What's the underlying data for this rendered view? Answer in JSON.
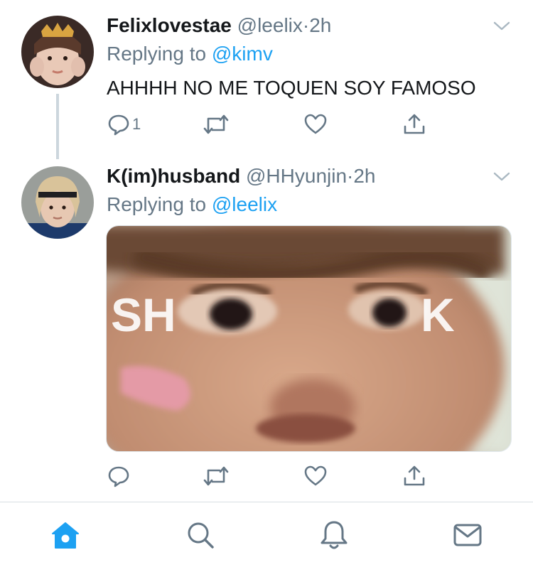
{
  "colors": {
    "accent": "#1da1f2",
    "secondary_text": "#657786",
    "icon_gray": "#657786",
    "thread_line": "#ccd6dd"
  },
  "tweets": [
    {
      "display_name": "Felixlovestae",
      "handle": "@leelix",
      "separator": "·",
      "time": "2h",
      "replying_prefix": "Replying to ",
      "replying_to": "@kimv",
      "text": "AHHHH NO ME TOQUEN SOY FAMOSO",
      "reply_count": "1",
      "actions": [
        "reply-icon",
        "retweet-icon",
        "like-icon",
        "share-icon"
      ]
    },
    {
      "display_name": "K(im)husband",
      "handle": "@HHyunjin",
      "separator": "·",
      "time": "2h",
      "replying_prefix": "Replying to ",
      "replying_to": "@leelix",
      "media_caption_left": "SH",
      "media_caption_right": "K",
      "actions": [
        "reply-icon",
        "retweet-icon",
        "like-icon",
        "share-icon"
      ]
    }
  ],
  "tabbar": {
    "items": [
      "home-icon",
      "search-icon",
      "notifications-icon",
      "messages-icon"
    ],
    "active": "home-icon"
  }
}
